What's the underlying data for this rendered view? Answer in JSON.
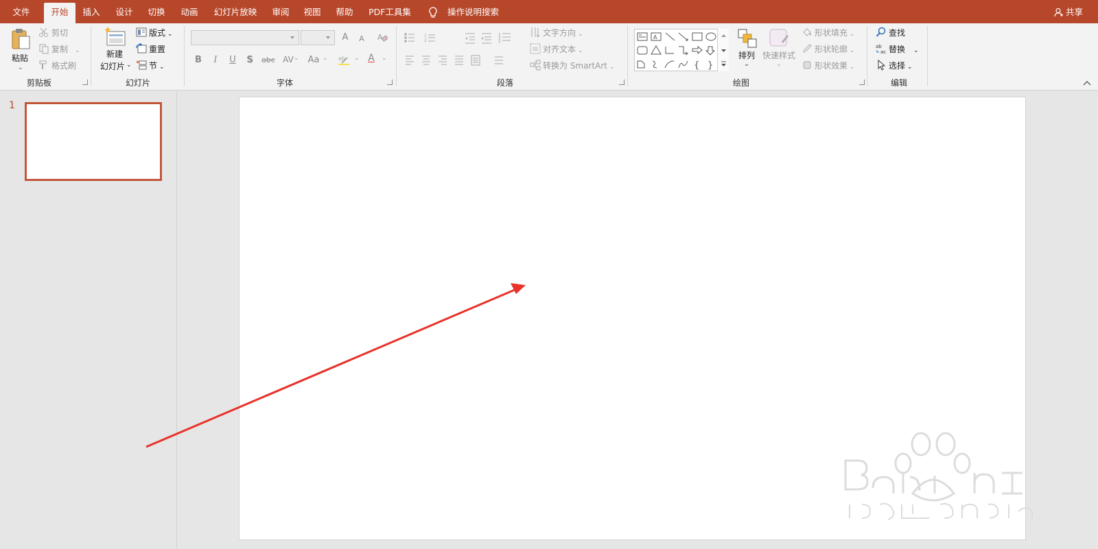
{
  "tabs": [
    {
      "label": "文件"
    },
    {
      "label": "开始",
      "active": true
    },
    {
      "label": "插入"
    },
    {
      "label": "设计"
    },
    {
      "label": "切换"
    },
    {
      "label": "动画"
    },
    {
      "label": "幻灯片放映"
    },
    {
      "label": "审阅"
    },
    {
      "label": "视图"
    },
    {
      "label": "帮助"
    },
    {
      "label": "PDF工具集"
    }
  ],
  "tell_me": "操作说明搜索",
  "share": "共享",
  "clipboard": {
    "paste": "粘贴",
    "cut": "剪切",
    "copy": "复制",
    "format_painter": "格式刷",
    "group": "剪贴板"
  },
  "slides_group": {
    "new_slide_line1": "新建",
    "new_slide_line2": "幻灯片",
    "layout": "版式",
    "reset": "重置",
    "section": "节",
    "group": "幻灯片"
  },
  "font": {
    "group": "字体",
    "bold": "B",
    "italic": "I",
    "underline": "U",
    "shadow": "S",
    "strike": "abc",
    "spacing": "AV",
    "case": "Aa",
    "color": "A",
    "grow": "A",
    "shrink": "A"
  },
  "paragraph": {
    "group": "段落",
    "text_direction": "文字方向",
    "align_text": "对齐文本",
    "smartart": "转换为 SmartArt"
  },
  "drawing": {
    "group": "绘图",
    "arrange": "排列",
    "quick_styles": "快速样式",
    "shape_fill": "形状填充",
    "shape_outline": "形状轮廓",
    "shape_effects": "形状效果"
  },
  "editing": {
    "group": "编辑",
    "find": "查找",
    "replace": "替换",
    "select": "选择"
  },
  "thumbnails": {
    "slide_number": "1"
  },
  "colors": {
    "accent": "#b7472a",
    "annotation_arrow": "#e8322a"
  }
}
